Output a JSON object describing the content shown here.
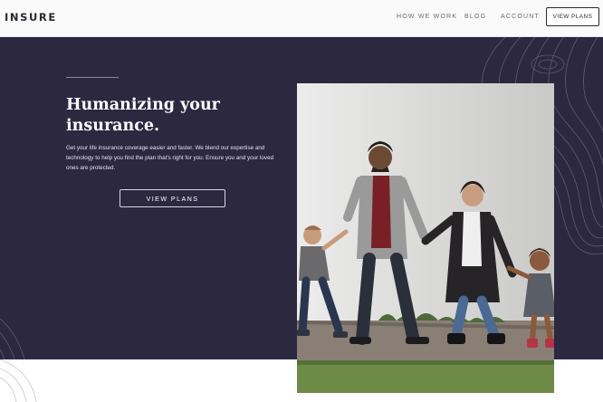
{
  "header": {
    "logo": "INSURE",
    "nav": {
      "how_we_work": "HOW WE WORK",
      "blog": "BLOG",
      "account": "ACCOUNT"
    },
    "cta_label": "VIEW PLANS"
  },
  "hero": {
    "headline": "Humanizing your insurance.",
    "description": "Get your life insurance coverage easier and faster. We blend our expertise and technology to help you find the plan that's right for you. Ensure you and your loved ones are protected.",
    "cta_label": "VIEW PLANS",
    "image_subject": "family walking together holding hands"
  },
  "colors": {
    "hero_bg": "#2c2840",
    "header_bg": "#fafafa",
    "text_dark": "#2c2830",
    "accent_line": "#8a8698"
  }
}
